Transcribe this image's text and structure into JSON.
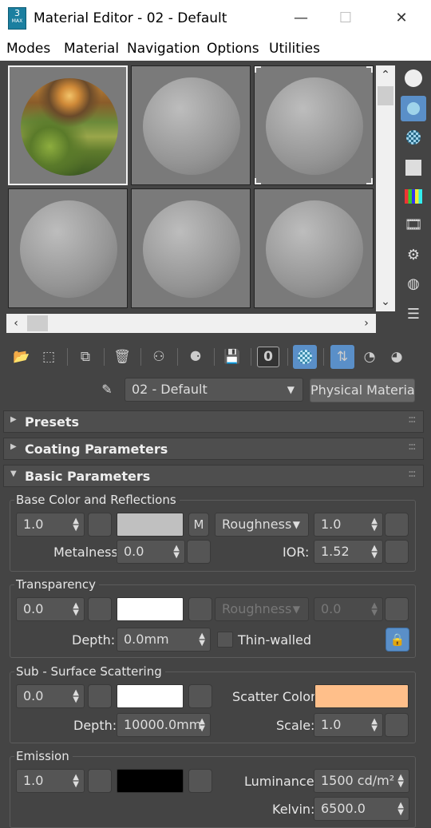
{
  "window": {
    "title": "Material Editor - 02 - Default",
    "app_icon_text": "3",
    "app_icon_sub": "MAX",
    "minimize": "—",
    "maximize": "☐",
    "close": "✕"
  },
  "menu": [
    "Modes",
    "Material",
    "Navigation",
    "Options",
    "Utilities"
  ],
  "material": {
    "name": "02 - Default",
    "type": "Physical Material"
  },
  "rollouts": {
    "presets": "Presets",
    "coating": "Coating Parameters",
    "basic": "Basic Parameters"
  },
  "base_color": {
    "title": "Base Color and Reflections",
    "weight": "1.0",
    "map_label": "M",
    "roughness_mode": "Roughness",
    "roughness": "1.0",
    "metalness_label": "Metalness:",
    "metalness": "0.0",
    "ior_label": "IOR:",
    "ior": "1.52",
    "color": "#c0c0c0"
  },
  "transparency": {
    "title": "Transparency",
    "weight": "0.0",
    "roughness_mode": "Roughness",
    "roughness": "0.0",
    "depth_label": "Depth:",
    "depth": "0.0mm",
    "thin_walled_label": "Thin-walled",
    "color": "#ffffff"
  },
  "sss": {
    "title": "Sub - Surface Scattering",
    "weight": "0.0",
    "scatter_label": "Scatter Color:",
    "scatter_color": "#ffbf8a",
    "depth_label": "Depth:",
    "depth": "10000.0mm",
    "scale_label": "Scale:",
    "scale": "1.0",
    "color": "#ffffff"
  },
  "emission": {
    "title": "Emission",
    "weight": "1.0",
    "luminance_label": "Luminance:",
    "luminance": "1500 cd/m²",
    "kelvin_label": "Kelvin:",
    "kelvin": "6500.0",
    "color": "#000000"
  },
  "colors": {
    "accent": "#5a8fc8",
    "panel": "#444444"
  },
  "icons": {
    "lock": "lock-icon",
    "eyedropper": "eyedropper-icon"
  }
}
